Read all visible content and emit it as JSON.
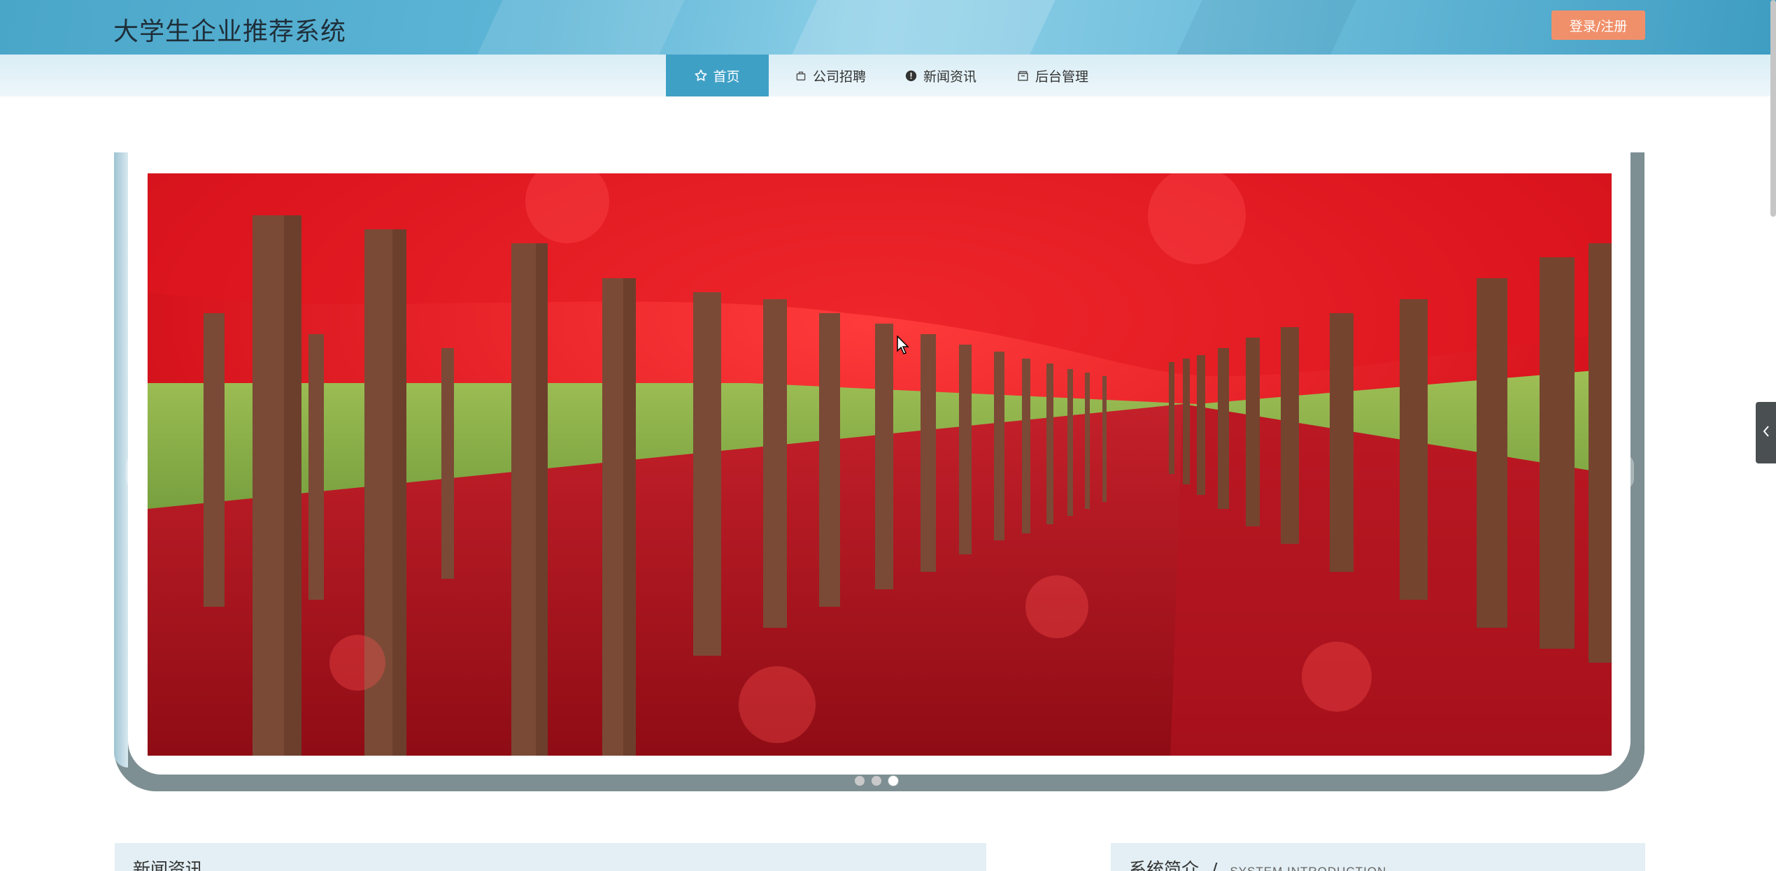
{
  "header": {
    "title": "大学生企业推荐系统",
    "login_label": "登录/注册"
  },
  "nav": {
    "items": [
      {
        "label": "首页",
        "icon": "star-icon",
        "active": true
      },
      {
        "label": "公司招聘",
        "icon": "bag-icon",
        "active": false
      },
      {
        "label": "新闻资讯",
        "icon": "info-icon",
        "active": false
      },
      {
        "label": "后台管理",
        "icon": "archive-icon",
        "active": false
      }
    ]
  },
  "carousel": {
    "slide_count": 3,
    "active_index": 2,
    "image_description_icon": "red-maple-avenue-photo"
  },
  "sections": {
    "news_title": "新闻资讯",
    "intro_title": "系统简介",
    "intro_separator": "/",
    "intro_subtitle": "SYSTEM INTRODUCTION"
  },
  "colors": {
    "header_accent": "#4aa6c9",
    "nav_active": "#3fa0c6",
    "login_button": "#f0906a"
  }
}
